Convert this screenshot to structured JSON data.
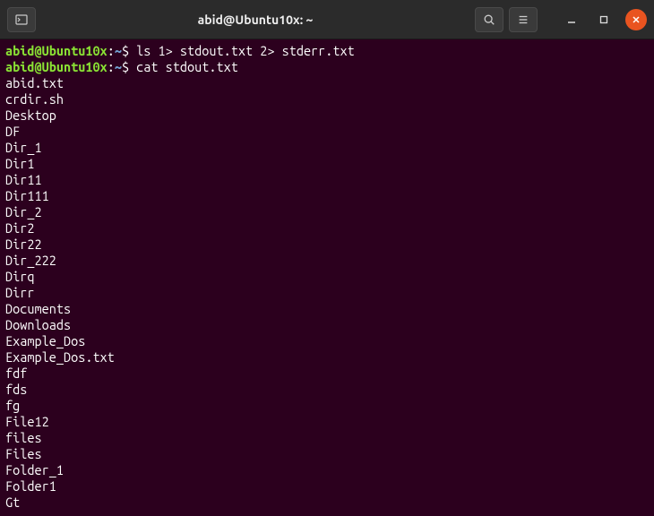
{
  "titlebar": {
    "title": "abid@Ubuntu10x: ~"
  },
  "prompt": {
    "user_host": "abid@Ubuntu10x",
    "colon": ":",
    "path": "~",
    "dollar": "$"
  },
  "commands": [
    {
      "text": " ls 1> stdout.txt 2> stderr.txt"
    },
    {
      "text": " cat stdout.txt"
    }
  ],
  "output": [
    "abid.txt",
    "crdir.sh",
    "Desktop",
    "DF",
    "Dir_1",
    "Dir1",
    "Dir11",
    "Dir111",
    "Dir_2",
    "Dir2",
    "Dir22",
    "Dir_222",
    "Dirq",
    "Dirr",
    "Documents",
    "Downloads",
    "Example_Dos",
    "Example_Dos.txt",
    "fdf",
    "fds",
    "fg",
    "File12",
    "files",
    "Files",
    "Folder_1",
    "Folder1",
    "Gt"
  ]
}
